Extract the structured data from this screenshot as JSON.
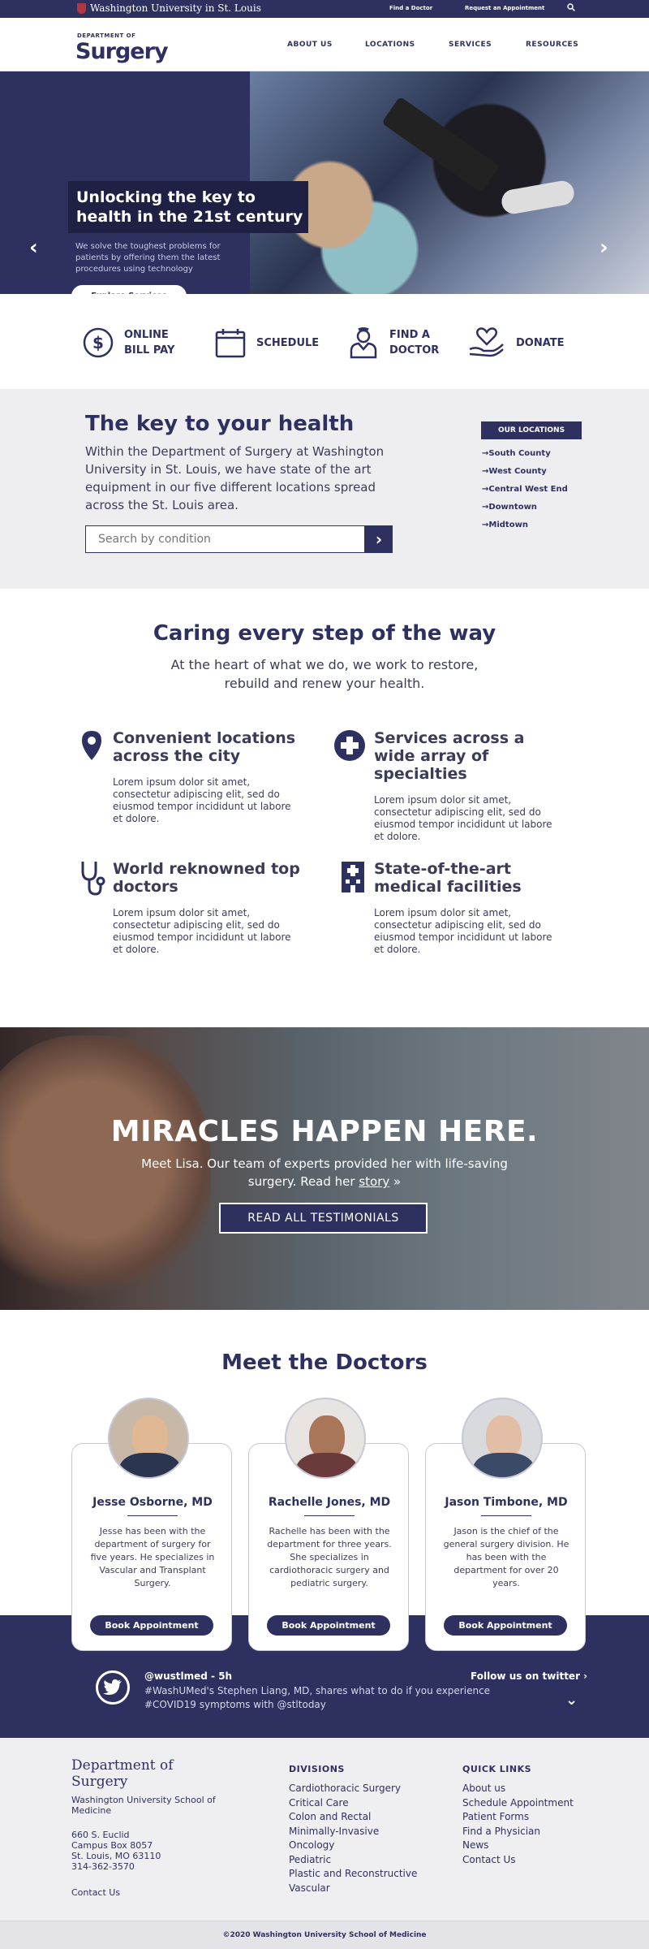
{
  "topbar": {
    "university": "Washington University in St. Louis",
    "find_doctor": "Find a Doctor",
    "request_appointment": "Request an Appointment"
  },
  "header": {
    "dept_label": "DEPARTMENT OF",
    "brand": "Surgery",
    "nav": [
      "ABOUT US",
      "LOCATIONS",
      "SERVICES",
      "RESOURCES"
    ]
  },
  "hero": {
    "headline": "Unlocking the key to health in the 21st century",
    "subtext": "We solve the toughest problems for patients by offering them the latest procedures using technology",
    "cta": "Explore Services",
    "slide_count": 4,
    "active_slide": 1
  },
  "quick_links": [
    {
      "label": "ONLINE BILL PAY",
      "icon": "dollar-icon"
    },
    {
      "label": "SCHEDULE",
      "icon": "calendar-icon"
    },
    {
      "label": "FIND A DOCTOR",
      "icon": "doctor-icon"
    },
    {
      "label": "DONATE",
      "icon": "heart-hand-icon"
    }
  ],
  "key_section": {
    "title": "The key to your health",
    "body": "Within the Department of Surgery at Washington University in St. Louis, we have state of the art equipment in our five different locations spread across the St. Louis area.",
    "search_placeholder": "Search by condition",
    "locations_heading": "OUR LOCATIONS",
    "locations": [
      "South County",
      "West County",
      "Central West End",
      "Downtown",
      "Midtown"
    ]
  },
  "caring": {
    "title": "Caring every step of the way",
    "lead": "At the heart of what we do, we work to restore, rebuild and renew your health.",
    "features": [
      {
        "title": "Convenient locations across the city",
        "text": "Lorem ipsum dolor sit amet, consectetur adipiscing elit, sed do eiusmod tempor incididunt ut labore et dolore.",
        "icon": "map-pin-icon"
      },
      {
        "title": "Services across a wide array of specialties",
        "text": "Lorem ipsum dolor sit amet, consectetur adipiscing elit, sed do eiusmod tempor incididunt ut labore et dolore.",
        "icon": "medical-cross-icon"
      },
      {
        "title": "World reknowned top doctors",
        "text": "Lorem ipsum dolor sit amet, consectetur adipiscing elit, sed do eiusmod tempor incididunt ut labore et dolore.",
        "icon": "stethoscope-icon"
      },
      {
        "title": "State-of-the-art medical facilities",
        "text": "Lorem ipsum dolor sit amet, consectetur adipiscing elit, sed do eiusmod tempor incididunt ut labore et dolore.",
        "icon": "hospital-icon"
      }
    ]
  },
  "testimonial": {
    "headline": "MIRACLES HAPPEN HERE.",
    "text_before": "Meet Lisa.  Our team of experts provided her with life-saving surgery.  Read her ",
    "link": "story",
    "link_suffix": " »",
    "button": "READ ALL TESTIMONIALS"
  },
  "doctors": {
    "title": "Meet the Doctors",
    "list": [
      {
        "name": "Jesse Osborne, MD",
        "bio": "Jesse has been with the department of surgery for five years.  He specializes in Vascular and Transplant Surgery.",
        "button": "Book Appointment"
      },
      {
        "name": "Rachelle Jones, MD",
        "bio": "Rachelle has been with the department for three years.  She specializes in cardiothoracic surgery and pediatric surgery.",
        "button": "Book Appointment"
      },
      {
        "name": "Jason Timbone, MD",
        "bio": "Jason is the chief of the general surgery division.  He has been with the department for over 20 years.",
        "button": "Book Appointment"
      }
    ]
  },
  "twitter": {
    "handle": "@wustlmed - 5h",
    "tweet": "#WashUMed's Stephen Liang, MD, shares what to do if you experience #COVID19 symptoms with @stltoday",
    "follow": "Follow us on twitter ›"
  },
  "footer": {
    "dept": "Department of Surgery",
    "school": "Washington University School of Medicine",
    "address": [
      "660 S. Euclid",
      "Campus Box 8057",
      "St. Louis, MO 63110",
      "314-362-3570"
    ],
    "contact": "Contact Us",
    "divisions_heading": "DIVISIONS",
    "divisions": [
      "Cardiothoracic Surgery",
      "Critical Care",
      "Colon and Rectal",
      "Minimally-Invasive",
      "Oncology",
      "Pediatric",
      "Plastic and Reconstructive",
      "Vascular"
    ],
    "quick_heading": "QUICK LINKS",
    "quick_links": [
      "About us",
      "Schedule Appointment",
      "Patient Forms",
      "Find a Physician",
      "News",
      "Contact Us"
    ],
    "copyright": "©2020 Washington University School of Medicine"
  }
}
